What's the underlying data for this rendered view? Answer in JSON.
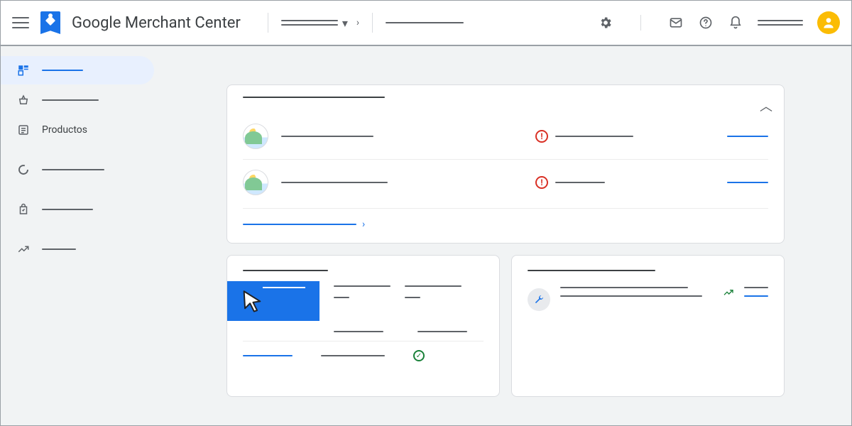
{
  "header": {
    "app_title": "Google Merchant Center",
    "account_selector": {
      "label_placeholder": "",
      "has_dropdown": true,
      "has_breadcrumb_caret": true
    },
    "secondary_placeholder": "",
    "icons": [
      "settings",
      "mail",
      "help",
      "notifications"
    ],
    "user_placeholder": ""
  },
  "sidebar": {
    "items": [
      {
        "id": "overview",
        "icon": "dashboard",
        "label_placeholder": "",
        "active": true
      },
      {
        "id": "shopping",
        "icon": "basket",
        "label_placeholder": "",
        "active": false
      },
      {
        "id": "products",
        "icon": "list",
        "label": "Productos",
        "active": false
      },
      {
        "id": "performance",
        "icon": "donut",
        "label_placeholder": "",
        "active": false
      },
      {
        "id": "orders",
        "icon": "bag-check",
        "label_placeholder": "",
        "active": false
      },
      {
        "id": "growth",
        "icon": "trend",
        "label_placeholder": "",
        "active": false
      }
    ]
  },
  "main": {
    "issues_card": {
      "title_placeholder": "",
      "collapsed": false,
      "rows": [
        {
          "image": "product-thumb",
          "desc_placeholder": "",
          "status_icon": "error",
          "status_placeholder": "",
          "action_link_placeholder": ""
        },
        {
          "image": "product-thumb",
          "desc_placeholder": "",
          "status_icon": "error",
          "status_placeholder": "",
          "action_link_placeholder": ""
        }
      ],
      "footer_link_placeholder": ""
    },
    "stats_card": {
      "title_placeholder": "",
      "highlighted_block": {
        "label_placeholder": "",
        "cursor_overlay": true
      },
      "columns": [
        {
          "label_placeholder": "",
          "value_placeholder": ""
        },
        {
          "label_placeholder": "",
          "value_placeholder": ""
        }
      ],
      "second_row": [
        {
          "placeholder": ""
        },
        {
          "placeholder": ""
        }
      ],
      "footer": {
        "link_placeholder": "",
        "stat_placeholder": "",
        "status_icon": "ok"
      }
    },
    "insights_card": {
      "title_placeholder": "",
      "item": {
        "icon": "wrench",
        "line1_placeholder": "",
        "line2_placeholder": "",
        "trend": "up",
        "meta_placeholder": "",
        "action_link_placeholder": ""
      }
    }
  },
  "colors": {
    "brand_blue": "#1a73e8",
    "error_red": "#d93025",
    "ok_green": "#188038",
    "avatar_yellow": "#fbbc04"
  }
}
